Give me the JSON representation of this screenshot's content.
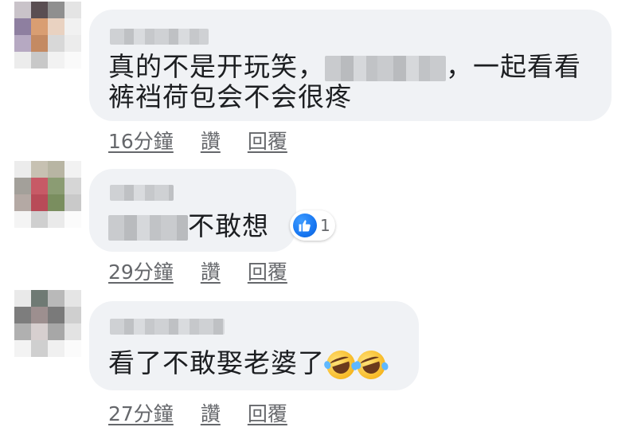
{
  "comments": [
    {
      "text_before": "真的不是开玩笑，",
      "text_after": "，一起看看",
      "text_line2": "裤裆荷包会不会很疼",
      "time": "16分鐘",
      "like": "讚",
      "reply": "回覆"
    },
    {
      "text_after": "不敢想",
      "reaction_count": "1",
      "time": "29分鐘",
      "like": "讚",
      "reply": "回覆"
    },
    {
      "text": "看了不敢娶老婆了",
      "emoji_name": "rolling-on-floor-laughing",
      "time": "27分鐘",
      "like": "讚",
      "reply": "回覆"
    }
  ],
  "colors": {
    "bubble": "#f0f2f5",
    "meta_text": "#65676b",
    "like_blue": "#1877f2"
  }
}
